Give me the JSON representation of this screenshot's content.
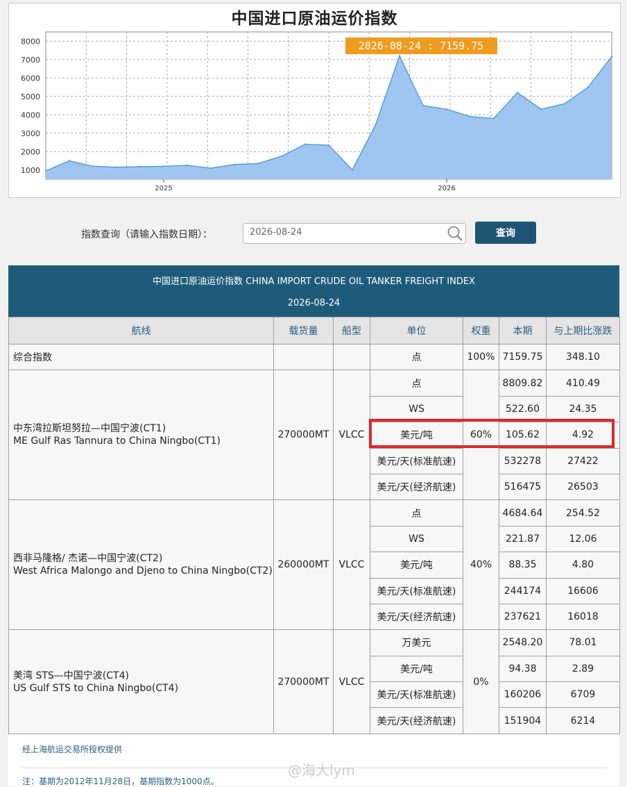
{
  "chart_title": "中国进口原油运价指数",
  "chart_data": {
    "type": "area",
    "x": [
      "2024-08",
      "2024-09",
      "2024-10",
      "2024-11",
      "2024-12",
      "2025-01",
      "2025-02",
      "2025-03",
      "2025-04",
      "2025-05",
      "2025-06",
      "2025-07",
      "2025-08",
      "2025-09",
      "2025-10",
      "2025-11",
      "2025-12",
      "2026-01",
      "2026-02",
      "2026-03",
      "2026-04",
      "2026-05",
      "2026-06",
      "2026-07",
      "2026-08-24"
    ],
    "series": [
      {
        "values": [
          950,
          1500,
          1200,
          1150,
          1180,
          1200,
          1250,
          1100,
          1300,
          1350,
          1750,
          2400,
          2350,
          1000,
          3500,
          7200,
          4500,
          4300,
          3900,
          3800,
          5200,
          4300,
          4600,
          5500,
          7159.75
        ]
      }
    ],
    "y_ticks": [
      1000,
      2000,
      3000,
      4000,
      5000,
      6000,
      7000,
      8000
    ],
    "x_tick_labels": [
      "2025",
      "2026"
    ],
    "ylim": [
      500,
      8500
    ],
    "tooltip": "2026-08-24 : 7159.75",
    "fill_color": "#9ec6f0",
    "line_color": "#5b9bd5"
  },
  "search": {
    "label": "指数查询（请输入指数日期）：",
    "value": "2026-08-24",
    "button": "查询"
  },
  "table": {
    "title": "中国进口原油运价指数 CHINA IMPORT CRUDE OIL TANKER FREIGHT INDEX",
    "date": "2026-08-24",
    "headers": [
      "航线",
      "载货量",
      "船型",
      "单位",
      "权重",
      "本期",
      "与上期比涨跌"
    ],
    "composite": {
      "name": "综合指数",
      "unit": "点",
      "weight": "100%",
      "current": "7159.75",
      "change": "348.10"
    },
    "routes": [
      {
        "name_cn": "中东湾拉斯坦努拉—中国宁波(CT1)",
        "name_en": "ME Gulf Ras Tannura to China Ningbo(CT1)",
        "capacity": "270000MT",
        "ship": "VLCC",
        "weight": "60%",
        "rows": [
          {
            "unit": "点",
            "current": "8809.82",
            "change": "410.49"
          },
          {
            "unit": "WS",
            "current": "522.60",
            "change": "24.35"
          },
          {
            "unit": "美元/吨",
            "current": "105.62",
            "change": "4.92"
          },
          {
            "unit": "美元/天(标准航速)",
            "current": "532278",
            "change": "27422"
          },
          {
            "unit": "美元/天(经济航速)",
            "current": "516475",
            "change": "26503"
          }
        ]
      },
      {
        "name_cn": "西非马隆格/ 杰诺—中国宁波(CT2)",
        "name_en": "West Africa Malongo and Djeno to China Ningbo(CT2)",
        "capacity": "260000MT",
        "ship": "VLCC",
        "weight": "40%",
        "rows": [
          {
            "unit": "点",
            "current": "4684.64",
            "change": "254.52"
          },
          {
            "unit": "WS",
            "current": "221.87",
            "change": "12.06"
          },
          {
            "unit": "美元/吨",
            "current": "88.35",
            "change": "4.80"
          },
          {
            "unit": "美元/天(标准航速)",
            "current": "244174",
            "change": "16606"
          },
          {
            "unit": "美元/天(经济航速)",
            "current": "237621",
            "change": "16018"
          }
        ]
      },
      {
        "name_cn": "美湾 STS—中国宁波(CT4)",
        "name_en": "US Gulf STS to China Ningbo(CT4)",
        "capacity": "270000MT",
        "ship": "VLCC",
        "weight": "0%",
        "rows": [
          {
            "unit": "万美元",
            "current": "2548.20",
            "change": "78.01"
          },
          {
            "unit": "美元/吨",
            "current": "94.38",
            "change": "2.89"
          },
          {
            "unit": "美元/天(标准航速)",
            "current": "160206",
            "change": "6709"
          },
          {
            "unit": "美元/天(经济航速)",
            "current": "151904",
            "change": "6214"
          }
        ]
      }
    ]
  },
  "footer": {
    "source": "经上海航运交易所授权提供",
    "note": "注：基期为2012年11月28日，基期指数为1000点。"
  },
  "watermark": "@海大lym",
  "colors": {
    "header_bg": "#1e5b7b",
    "button_bg": "#1f5574",
    "highlight": "#e0252b"
  }
}
